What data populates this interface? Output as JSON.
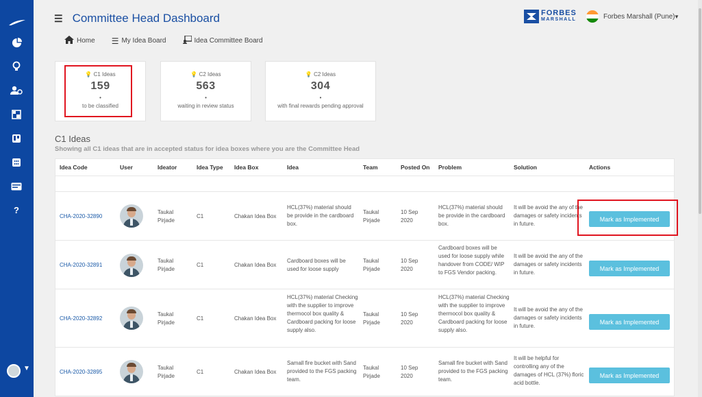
{
  "app": {
    "title": "Committee Head Dashboard"
  },
  "brand": {
    "name": "FORBES",
    "sub": "MARSHALL"
  },
  "user": {
    "name": "Forbes Marshall (Pune)"
  },
  "sidebar": {
    "icons": [
      "logo-icon",
      "chart-pie-icon",
      "lightbulb-icon",
      "users-icon",
      "dashboard-icon",
      "board-icon",
      "calculator-icon",
      "card-icon",
      "help-icon"
    ],
    "help_glyph": "?"
  },
  "nav": [
    {
      "label": "Home",
      "icon": "home-icon"
    },
    {
      "label": "My Idea Board",
      "icon": "list-icon"
    },
    {
      "label": "Idea Committee Board",
      "icon": "committee-icon"
    }
  ],
  "cards": [
    {
      "label": "C1 Ideas",
      "value": "159",
      "sub": "to be classified"
    },
    {
      "label": "C2 Ideas",
      "value": "563",
      "sub": "waiting in review status"
    },
    {
      "label": "C2 Ideas",
      "value": "304",
      "sub": "with final rewards pending approval"
    }
  ],
  "section": {
    "title": "C1 Ideas",
    "subtitle": "Showing all C1 ideas that are in accepted status for idea boxes where you are the Committee Head"
  },
  "table": {
    "columns": [
      "Idea Code",
      "User",
      "Ideator",
      "Idea Type",
      "Idea Box",
      "Idea",
      "Team",
      "Posted On",
      "Problem",
      "Solution",
      "Actions"
    ],
    "rows": [
      {
        "code": "CHA-2020-32890",
        "ideator": "Taukal Pirjade",
        "type": "C1",
        "box": "Chakan Idea Box",
        "idea": "HCL(37%) material should be provide in the cardboard box.",
        "team": "Taukal Pirjade",
        "posted": "10 Sep 2020",
        "problem": "HCL(37%) material should be provide in the cardboard box.",
        "solution": "It will be avoid the any of the damages or safety incidents in future.",
        "action": "Mark as Implemented"
      },
      {
        "code": "CHA-2020-32891",
        "ideator": "Taukal Pirjade",
        "type": "C1",
        "box": "Chakan Idea Box",
        "idea": "Cardboard boxes will be used for loose supply",
        "team": "Taukal Pirjade",
        "posted": "10 Sep 2020",
        "problem": "Cardboard boxes will be used for loose supply while handover from CODE/ WIP to FGS Vendor packing.",
        "solution": "It will be avoid the any of the damages or safety incidents in future.",
        "action": "Mark as Implemented"
      },
      {
        "code": "CHA-2020-32892",
        "ideator": "Taukal Pirjade",
        "type": "C1",
        "box": "Chakan Idea Box",
        "idea": "HCL(37%) material Checking with the supplier to improve thermocol box quality & Cardboard packing for loose supply also.",
        "team": "Taukal Pirjade",
        "posted": "10 Sep 2020",
        "problem": "HCL(37%) material Checking with the supplier to improve thermocol box quality & Cardboard packing for loose supply also.",
        "solution": "It will be avoid the any of the damages or safety incidents in future.",
        "action": "Mark as Implemented"
      },
      {
        "code": "CHA-2020-32895",
        "ideator": "Taukal Pirjade",
        "type": "C1",
        "box": "Chakan Idea Box",
        "idea": "Samall fire bucket with Sand provided to the FGS packing team.",
        "team": "Taukal Pirjade",
        "posted": "10 Sep 2020",
        "problem": "Samall fire bucket with Sand provided to the FGS packing team.",
        "solution": "It will be helpful for controlling any of the damages of HCL (37%) floric acid bottle.",
        "action": "Mark as Implemented"
      }
    ]
  },
  "colors": {
    "sidebar": "#0d47a1",
    "accent": "#1a4fa3",
    "button": "#5bc0de",
    "highlight": "#e0141f"
  }
}
